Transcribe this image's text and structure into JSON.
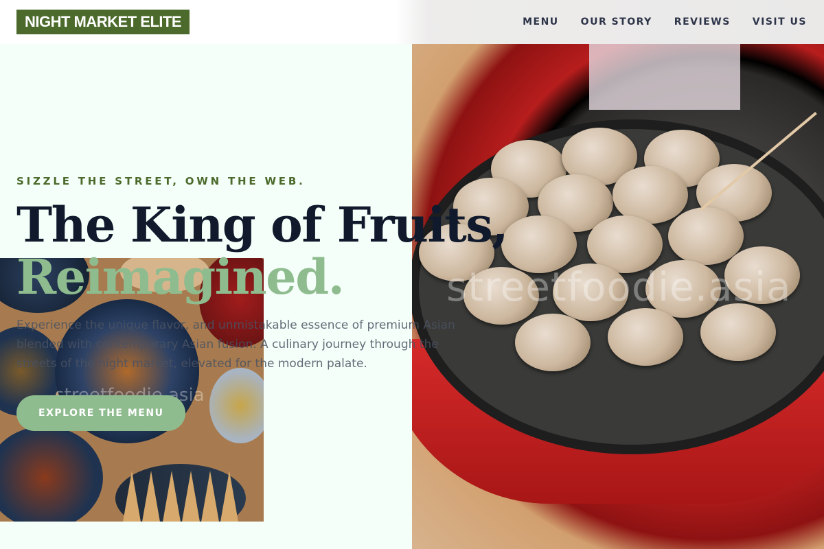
{
  "brand": {
    "logo_text": "NIGHT MARKET ELITE"
  },
  "nav": {
    "items": [
      "MENU",
      "OUR STORY",
      "REVIEWS",
      "VISIT US"
    ]
  },
  "hero": {
    "eyebrow": "SIZZLE THE STREET, OWN THE WEB.",
    "title_line1": "The King of Fruits,",
    "title_line2": "Reimagined.",
    "description": "Experience the unique flavor, and unmistakable essence of premium Asian blended with contemporary Asian fusion. A culinary journey through the streets of the night market, elevated for the modern palate.",
    "cta_label": "EXPLORE THE MENU"
  },
  "images": {
    "right_watermark": "streetfoodie.asia",
    "left_watermark": "streetfoodie.asia"
  },
  "colors": {
    "brand_green": "#4b6a2b",
    "accent_sage": "#8fbc8f",
    "heading_navy": "#111a2d",
    "background_mint": "#f5fff9"
  }
}
